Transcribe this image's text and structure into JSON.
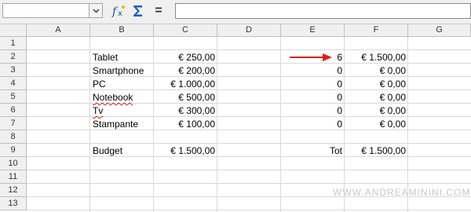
{
  "formula_bar": {
    "namebox_value": "",
    "input_value": "",
    "eq_label": "="
  },
  "columns": [
    "A",
    "B",
    "C",
    "D",
    "E",
    "F",
    "G"
  ],
  "rows": [
    "1",
    "2",
    "3",
    "4",
    "5",
    "6",
    "7",
    "8",
    "9",
    "10",
    "11",
    "12",
    "13"
  ],
  "sheet": {
    "items": [
      {
        "name": "Tablet",
        "price": "€ 250,00",
        "qty": "6",
        "total": "€ 1.500,00"
      },
      {
        "name": "Smartphone",
        "price": "€ 200,00",
        "qty": "0",
        "total": "€ 0,00"
      },
      {
        "name": "PC",
        "price": "€ 1.000,00",
        "qty": "0",
        "total": "€ 0,00"
      },
      {
        "name": "Notebook",
        "price": "€ 500,00",
        "qty": "0",
        "total": "€ 0,00"
      },
      {
        "name": "Tv",
        "price": "€ 300,00",
        "qty": "0",
        "total": "€ 0,00"
      },
      {
        "name": "Stampante",
        "price": "€ 100,00",
        "qty": "0",
        "total": "€ 0,00"
      }
    ],
    "budget_label": "Budget",
    "budget_value": "€ 1.500,00",
    "tot_label": "Tot",
    "tot_value": "€ 1.500,00"
  },
  "watermark": "WWW.ANDREAMININI.COM",
  "colors": {
    "arrow": "#e0201c",
    "spellcheck": "#d01b1b"
  }
}
